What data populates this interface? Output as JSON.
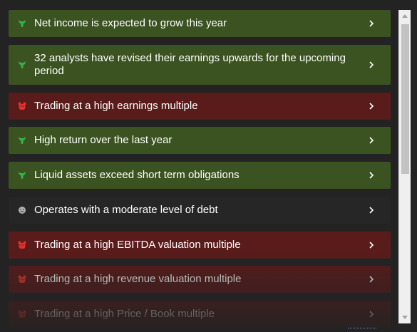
{
  "items": [
    {
      "kind": "bull",
      "text": "Net income is expected to grow this year"
    },
    {
      "kind": "bull",
      "text": "32 analysts have revised their earnings upwards for the upcoming period"
    },
    {
      "kind": "bear",
      "text": "Trading at a high earnings multiple"
    },
    {
      "kind": "bull",
      "text": "High return over the last year"
    },
    {
      "kind": "bull",
      "text": "Liquid assets exceed short term obligations"
    },
    {
      "kind": "neutral",
      "text": "Operates with a moderate level of debt"
    },
    {
      "kind": "bear",
      "text": "Trading at a high EBITDA valuation multiple"
    },
    {
      "kind": "bear",
      "text": "Trading at a high revenue valuation multiple"
    },
    {
      "kind": "bear",
      "text": "Trading at a high Price / Book multiple"
    }
  ],
  "icons": {
    "bull": "bull-icon",
    "bear": "bear-icon",
    "neutral": "neutral-face-icon",
    "chevron": "chevron-right-icon"
  },
  "colors": {
    "bull_bg": "#3b5320",
    "bear_bg": "#5a1b1b",
    "neutral_bg": "#262626",
    "bull_icon": "#2fb44a",
    "bear_icon": "#e0322e",
    "neutral_icon": "#b0b0b0"
  }
}
